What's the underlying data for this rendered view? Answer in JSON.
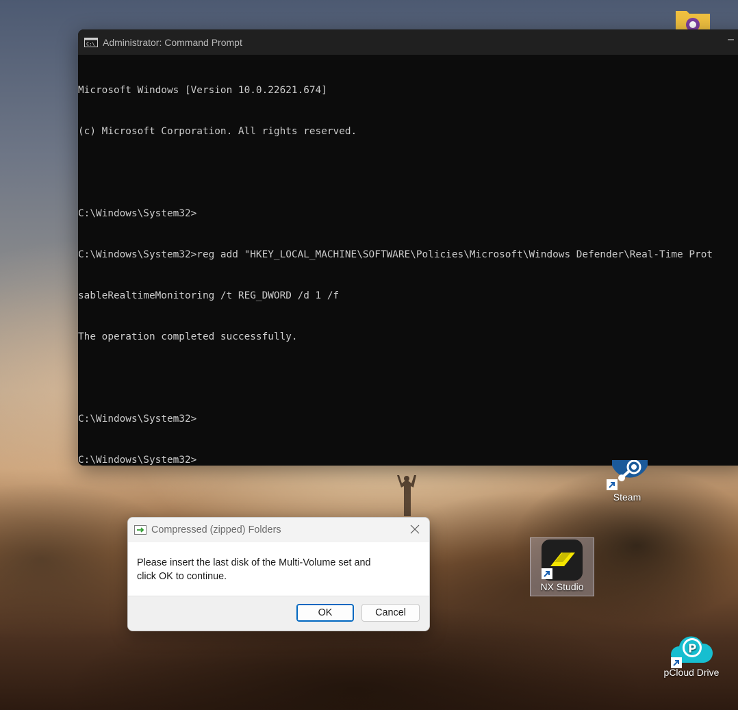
{
  "cmd_window": {
    "title": "Administrator: Command Prompt",
    "lines": [
      "Microsoft Windows [Version 10.0.22621.674]",
      "(c) Microsoft Corporation. All rights reserved.",
      "",
      "C:\\Windows\\System32>",
      "C:\\Windows\\System32>reg add \"HKEY_LOCAL_MACHINE\\SOFTWARE\\Policies\\Microsoft\\Windows Defender\\Real-Time Prot",
      "sableRealtimeMonitoring /t REG_DWORD /d 1 /f",
      "The operation completed successfully.",
      "",
      "C:\\Windows\\System32>",
      "C:\\Windows\\System32>"
    ]
  },
  "desktop": {
    "steam_label": "Steam",
    "nx_studio_label": "NX Studio",
    "pcloud_label": "pCloud Drive"
  },
  "dialog": {
    "title": "Compressed (zipped) Folders",
    "message_line1": "Please insert the last disk of the Multi-Volume set and",
    "message_line2": "click OK to continue.",
    "ok_label": "OK",
    "cancel_label": "Cancel"
  },
  "colors": {
    "cmd_bg": "#0c0c0c",
    "cmd_titlebar": "#202020",
    "ok_border": "#0067c0"
  }
}
